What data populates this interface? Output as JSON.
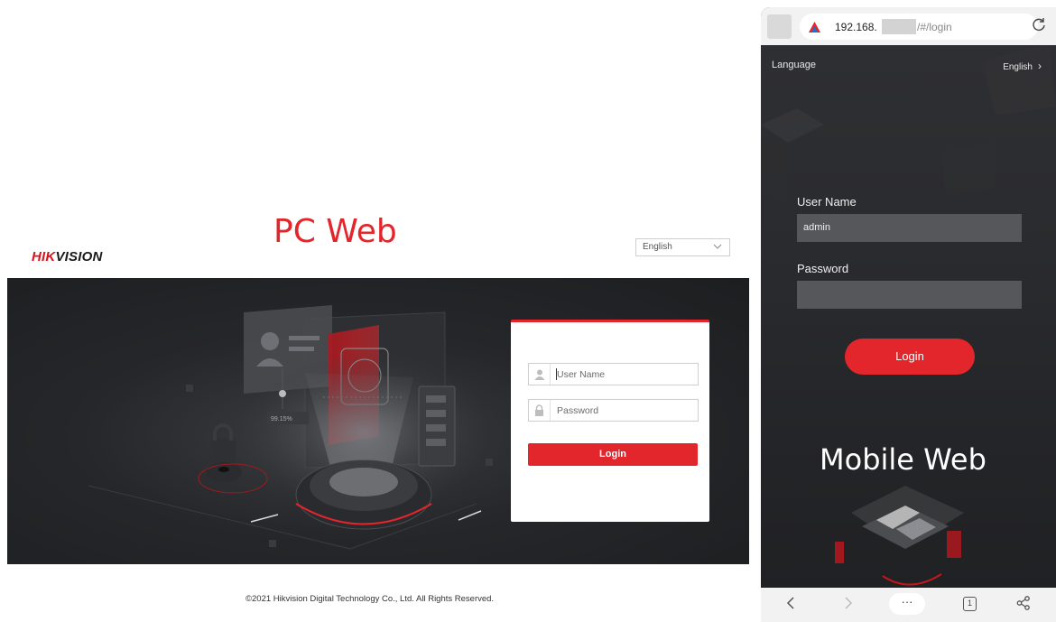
{
  "pc": {
    "caption": "PC Web",
    "logo": {
      "part1": "HIK",
      "part2": "VISION"
    },
    "language_select": {
      "value": "English"
    },
    "login": {
      "username_placeholder": "User Name",
      "password_placeholder": "Password",
      "button": "Login"
    },
    "footer": "©2021 Hikvision Digital Technology Co., Ltd. All Rights Reserved.",
    "banner_readout": "99.15%"
  },
  "mobile": {
    "caption": "Mobile Web",
    "browser": {
      "url_start": "192.168.",
      "url_end": "/#/login",
      "tab_count": "1",
      "more": "···"
    },
    "language_label": "Language",
    "language_value": "English",
    "username_label": "User Name",
    "username_value": "admin",
    "password_label": "Password",
    "password_value": "",
    "login_button": "Login"
  },
  "colors": {
    "accent": "#e3262b",
    "banner_bg": "#26272a",
    "mobile_bg": "#2a2b2e"
  },
  "icons": [
    "user-icon",
    "lock-icon",
    "chevron-down-icon",
    "chevron-right-icon",
    "reload-icon",
    "back-icon",
    "forward-icon",
    "more-icon",
    "tabs-icon",
    "share-icon",
    "site-icon"
  ]
}
